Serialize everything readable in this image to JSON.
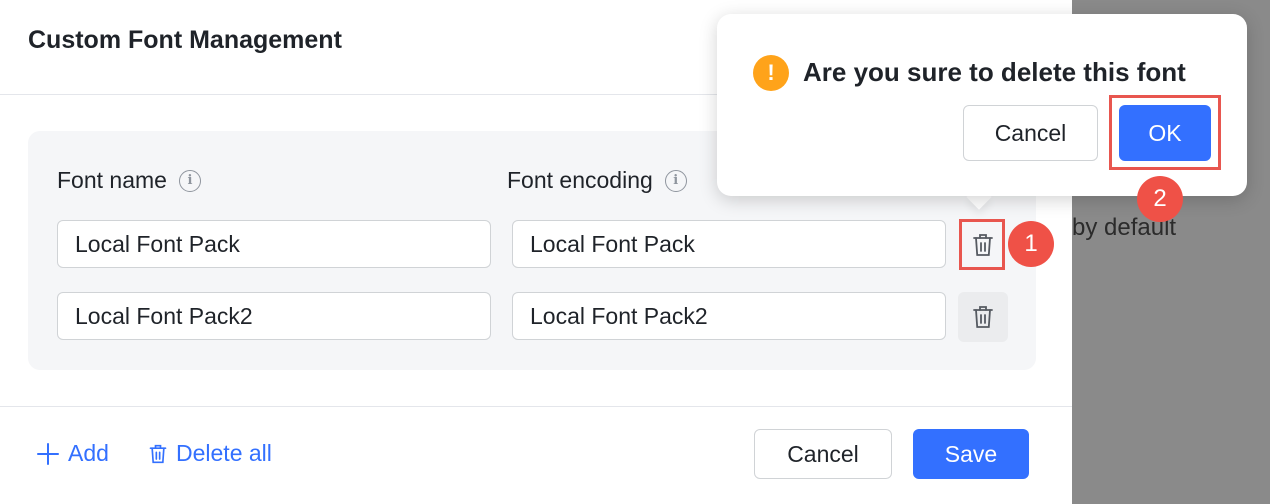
{
  "background": {
    "partial_text": "by default"
  },
  "dialog": {
    "title": "Custom Font Management",
    "columns": {
      "font_name": "Font name",
      "font_encoding": "Font encoding"
    },
    "rows": [
      {
        "font_name": "Local Font Pack",
        "font_encoding": "Local Font Pack"
      },
      {
        "font_name": "Local Font Pack2",
        "font_encoding": "Local Font Pack2"
      }
    ],
    "footer": {
      "add_label": "Add",
      "delete_all_label": "Delete all",
      "cancel_label": "Cancel",
      "save_label": "Save"
    }
  },
  "popconfirm": {
    "message": "Are you sure to delete this font",
    "cancel_label": "Cancel",
    "ok_label": "OK",
    "warn_glyph": "!"
  },
  "annotations": {
    "step1": "1",
    "step2": "2"
  },
  "icons": {
    "info": "info-circle-icon",
    "trash": "trash-icon",
    "plus": "plus-icon",
    "warning": "exclamation-circle-icon"
  },
  "colors": {
    "primary": "#3370ff",
    "warning": "#ffa31a",
    "annotation": "#ef5147",
    "overlay": "#8a8a8a"
  }
}
